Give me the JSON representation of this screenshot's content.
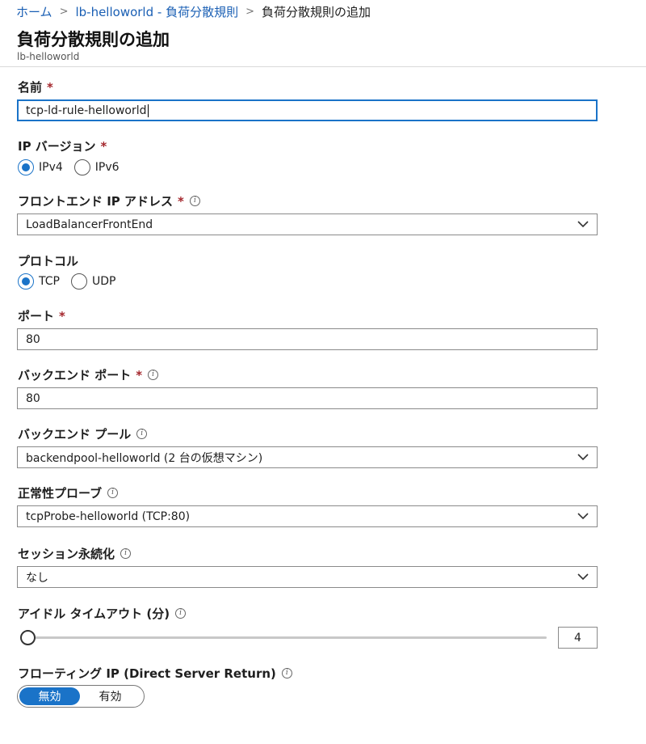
{
  "breadcrumb": {
    "home": "ホーム",
    "parent": "lb-helloworld - 負荷分散規則",
    "current": "負荷分散規則の追加"
  },
  "header": {
    "title": "負荷分散規則の追加",
    "subtitle": "lb-helloworld"
  },
  "form": {
    "name": {
      "label": "名前",
      "required": "*",
      "value": "tcp-ld-rule-helloworld"
    },
    "ip_version": {
      "label": "IP バージョン",
      "required": "*",
      "options": [
        "IPv4",
        "IPv6"
      ],
      "selected": "IPv4"
    },
    "frontend_ip": {
      "label": "フロントエンド IP アドレス",
      "required": "*",
      "value": "LoadBalancerFrontEnd"
    },
    "protocol": {
      "label": "プロトコル",
      "options": [
        "TCP",
        "UDP"
      ],
      "selected": "TCP"
    },
    "port": {
      "label": "ポート",
      "required": "*",
      "value": "80"
    },
    "backend_port": {
      "label": "バックエンド ポート",
      "required": "*",
      "value": "80"
    },
    "backend_pool": {
      "label": "バックエンド プール",
      "value": "backendpool-helloworld (2 台の仮想マシン)"
    },
    "health_probe": {
      "label": "正常性プローブ",
      "value": "tcpProbe-helloworld (TCP:80)"
    },
    "session_persistence": {
      "label": "セッション永続化",
      "value": "なし"
    },
    "idle_timeout": {
      "label": "アイドル タイムアウト (分)",
      "value": "4"
    },
    "floating_ip": {
      "label": "フローティング IP (Direct Server Return)",
      "options": [
        "無効",
        "有効"
      ],
      "selected": "無効"
    }
  },
  "icons": {
    "info": "info-icon",
    "chevron": "chevron-down-icon"
  },
  "colors": {
    "accent": "#1a73c8",
    "link": "#1a5fb4",
    "required": "#a4262c"
  }
}
